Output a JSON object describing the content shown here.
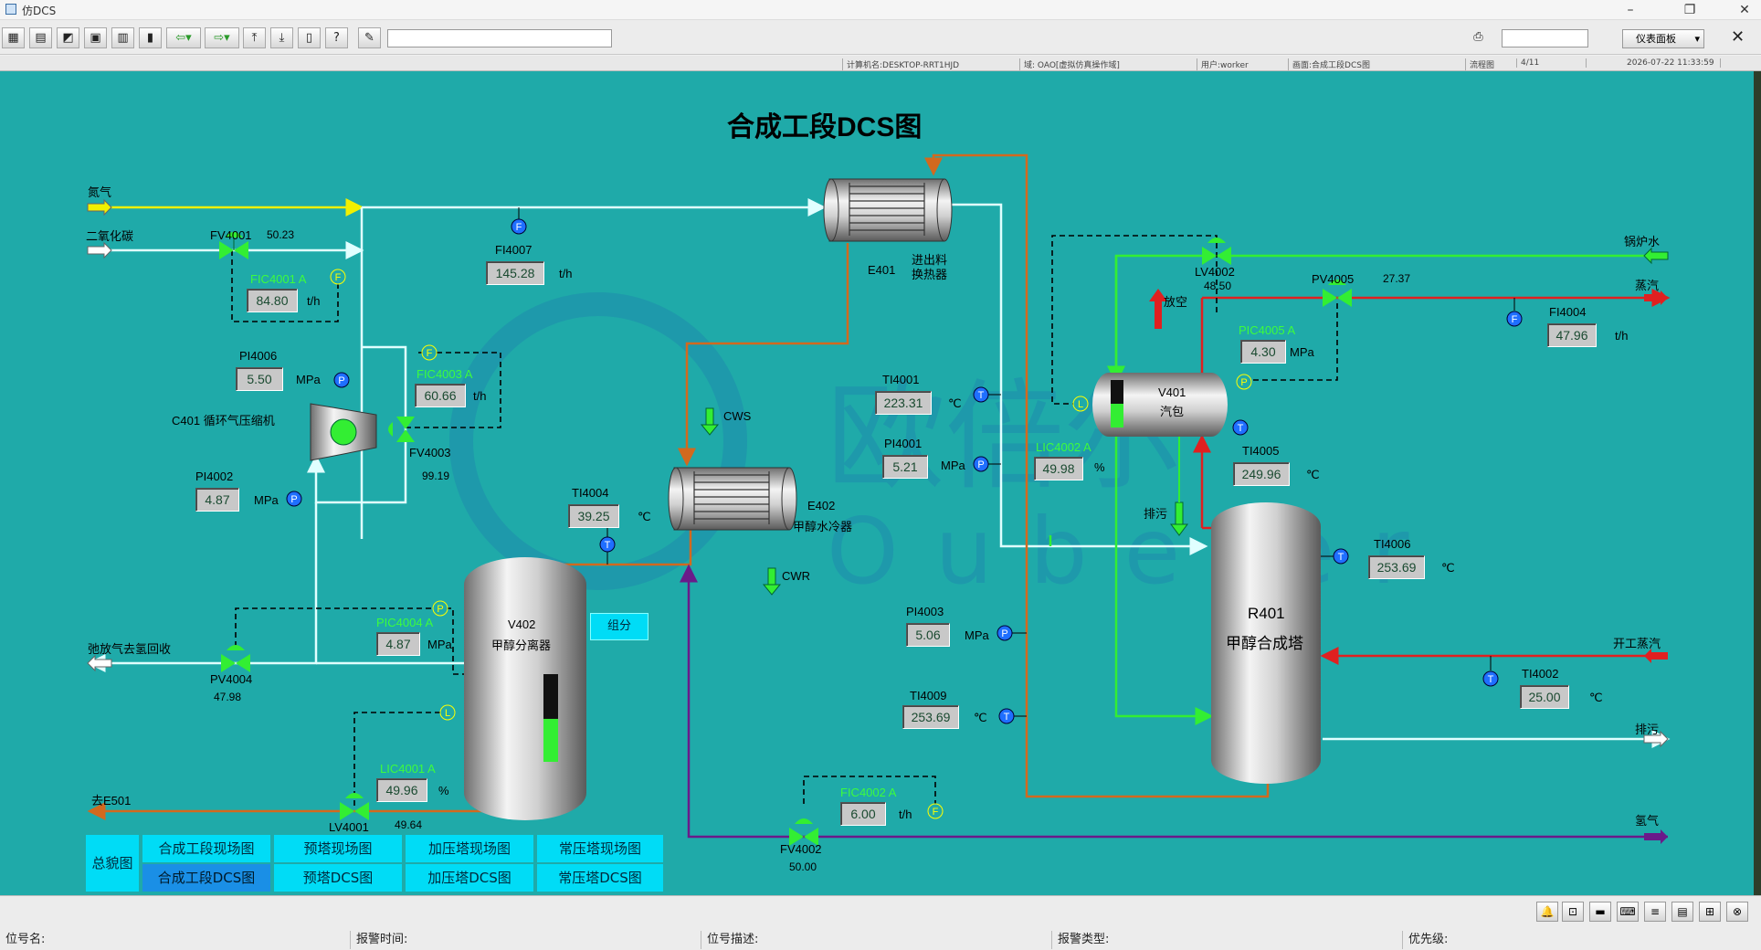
{
  "window": {
    "title": "仿DCS"
  },
  "toolbar": {
    "panel_label": "仪表面板"
  },
  "infobar": {
    "computer": "计算机名:DESKTOP-RRT1HJD",
    "domain": "域: OAO[虚拟仿真操作域]",
    "user": "用户:worker",
    "screen": "画面:合成工段DCS图",
    "flow": "流程图",
    "page": "4/11",
    "datetime": "2026-07-22 11:33:59"
  },
  "diagram": {
    "title": "合成工段DCS图",
    "watermark_cn": "欧倍尔",
    "watermark_en": "Oubeier",
    "streams": {
      "nitrogen": "氮气",
      "co2": "二氧化碳",
      "purge_gas": "弛放气去氢回收",
      "to_e501": "去E501",
      "boiler_water": "锅炉水",
      "steam": "蒸汽",
      "startup_steam": "开工蒸汽",
      "blowdown_r401": "排污",
      "hydrogen": "氢气",
      "vent": "放空",
      "blowdown_v401": "排污",
      "cws": "CWS",
      "cwr": "CWR"
    },
    "equipment": {
      "e401_tag": "E401",
      "e401_name1": "进出料",
      "e401_name2": "换热器",
      "e402_tag": "E402",
      "e402_name": "甲醇水冷器",
      "v402_tag": "V402",
      "v402_name": "甲醇分离器",
      "v401_tag": "V401",
      "v401_name": "汽包",
      "r401_tag": "R401",
      "r401_name": "甲醇合成塔",
      "c401": "C401 循环气压缩机"
    },
    "valves": {
      "fv4001": {
        "tag": "FV4001",
        "value": "50.23"
      },
      "fv4003": {
        "tag": "FV4003",
        "value": "99.19"
      },
      "pv4004": {
        "tag": "PV4004",
        "value": "47.98"
      },
      "lv4001": {
        "tag": "LV4001",
        "value": "49.64"
      },
      "fv4002": {
        "tag": "FV4002",
        "value": "50.00"
      },
      "lv4002": {
        "tag": "LV4002",
        "value": "48.50"
      },
      "pv4005": {
        "tag": "PV4005",
        "value": "27.37"
      }
    },
    "instruments": {
      "fic4001": {
        "tag": "FIC4001 A",
        "value": "84.80",
        "unit": "t/h"
      },
      "fi4007": {
        "tag": "FI4007",
        "value": "145.28",
        "unit": "t/h"
      },
      "pi4006": {
        "tag": "PI4006",
        "value": "5.50",
        "unit": "MPa"
      },
      "fic4003": {
        "tag": "FIC4003 A",
        "value": "60.66",
        "unit": "t/h"
      },
      "pi4002": {
        "tag": "PI4002",
        "value": "4.87",
        "unit": "MPa"
      },
      "ti4004": {
        "tag": "TI4004",
        "value": "39.25",
        "unit": "℃"
      },
      "pic4004": {
        "tag": "PIC4004 A",
        "value": "4.87",
        "unit": "MPa"
      },
      "lic4001": {
        "tag": "LIC4001 A",
        "value": "49.96",
        "unit": "%"
      },
      "ti4001": {
        "tag": "TI4001",
        "value": "223.31",
        "unit": "℃"
      },
      "pi4001": {
        "tag": "PI4001",
        "value": "5.21",
        "unit": "MPa"
      },
      "pi4003": {
        "tag": "PI4003",
        "value": "5.06",
        "unit": "MPa"
      },
      "ti4009": {
        "tag": "TI4009",
        "value": "253.69",
        "unit": "℃"
      },
      "fic4002": {
        "tag": "FIC4002 A",
        "value": "6.00",
        "unit": "t/h"
      },
      "lic4002": {
        "tag": "LIC4002 A",
        "value": "49.98",
        "unit": "%"
      },
      "pic4005": {
        "tag": "PIC4005 A",
        "value": "4.30",
        "unit": "MPa"
      },
      "fi4004": {
        "tag": "FI4004",
        "value": "47.96",
        "unit": "t/h"
      },
      "ti4005": {
        "tag": "TI4005",
        "value": "249.96",
        "unit": "℃"
      },
      "ti4006": {
        "tag": "TI4006",
        "value": "253.69",
        "unit": "℃"
      },
      "ti4002": {
        "tag": "TI4002",
        "value": "25.00",
        "unit": "℃"
      }
    },
    "component_button": "组分",
    "v402_level": 0.49,
    "v401_level": 0.5
  },
  "nav": {
    "overview": "总貌图",
    "items": [
      "合成工段现场图",
      "预塔现场图",
      "加压塔现场图",
      "常压塔现场图",
      "合成工段DCS图",
      "预塔DCS图",
      "加压塔DCS图",
      "常压塔DCS图"
    ]
  },
  "statusbar": {
    "tag_name": "位号名:",
    "alarm_time": "报警时间:",
    "tag_desc": "位号描述:",
    "alarm_type": "报警类型:",
    "priority": "优先级:"
  },
  "colors": {
    "background": "#1faaa9",
    "nitrogen": "#f0f000",
    "hot_line": "#d2691e",
    "water_line": "#33ee33",
    "steam_line": "#e02020",
    "hydrogen_line": "#6a1b8a",
    "gas_line": "#e0ffff"
  }
}
